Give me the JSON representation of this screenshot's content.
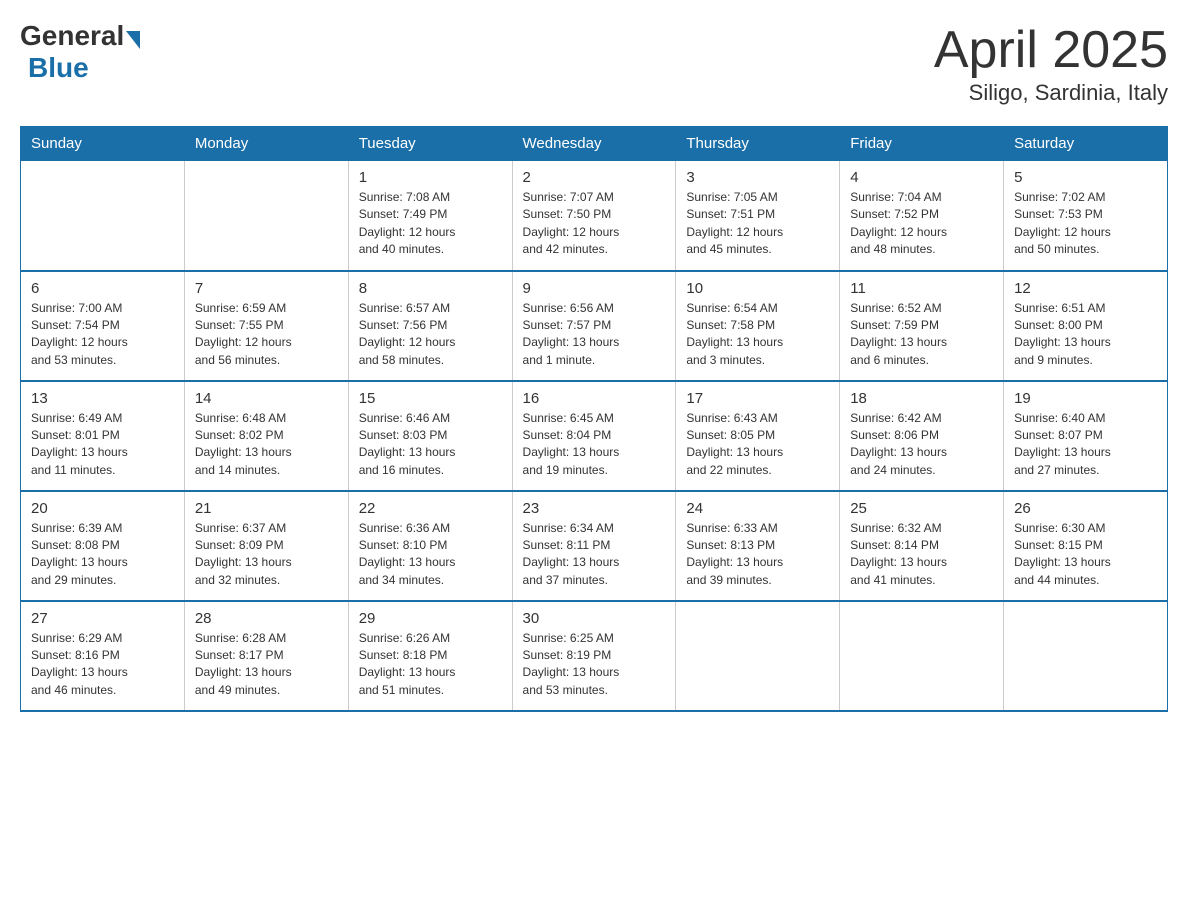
{
  "logo": {
    "general": "General",
    "blue": "Blue"
  },
  "title": "April 2025",
  "location": "Siligo, Sardinia, Italy",
  "days_of_week": [
    "Sunday",
    "Monday",
    "Tuesday",
    "Wednesday",
    "Thursday",
    "Friday",
    "Saturday"
  ],
  "weeks": [
    [
      {
        "day": "",
        "info": ""
      },
      {
        "day": "",
        "info": ""
      },
      {
        "day": "1",
        "info": "Sunrise: 7:08 AM\nSunset: 7:49 PM\nDaylight: 12 hours\nand 40 minutes."
      },
      {
        "day": "2",
        "info": "Sunrise: 7:07 AM\nSunset: 7:50 PM\nDaylight: 12 hours\nand 42 minutes."
      },
      {
        "day": "3",
        "info": "Sunrise: 7:05 AM\nSunset: 7:51 PM\nDaylight: 12 hours\nand 45 minutes."
      },
      {
        "day": "4",
        "info": "Sunrise: 7:04 AM\nSunset: 7:52 PM\nDaylight: 12 hours\nand 48 minutes."
      },
      {
        "day": "5",
        "info": "Sunrise: 7:02 AM\nSunset: 7:53 PM\nDaylight: 12 hours\nand 50 minutes."
      }
    ],
    [
      {
        "day": "6",
        "info": "Sunrise: 7:00 AM\nSunset: 7:54 PM\nDaylight: 12 hours\nand 53 minutes."
      },
      {
        "day": "7",
        "info": "Sunrise: 6:59 AM\nSunset: 7:55 PM\nDaylight: 12 hours\nand 56 minutes."
      },
      {
        "day": "8",
        "info": "Sunrise: 6:57 AM\nSunset: 7:56 PM\nDaylight: 12 hours\nand 58 minutes."
      },
      {
        "day": "9",
        "info": "Sunrise: 6:56 AM\nSunset: 7:57 PM\nDaylight: 13 hours\nand 1 minute."
      },
      {
        "day": "10",
        "info": "Sunrise: 6:54 AM\nSunset: 7:58 PM\nDaylight: 13 hours\nand 3 minutes."
      },
      {
        "day": "11",
        "info": "Sunrise: 6:52 AM\nSunset: 7:59 PM\nDaylight: 13 hours\nand 6 minutes."
      },
      {
        "day": "12",
        "info": "Sunrise: 6:51 AM\nSunset: 8:00 PM\nDaylight: 13 hours\nand 9 minutes."
      }
    ],
    [
      {
        "day": "13",
        "info": "Sunrise: 6:49 AM\nSunset: 8:01 PM\nDaylight: 13 hours\nand 11 minutes."
      },
      {
        "day": "14",
        "info": "Sunrise: 6:48 AM\nSunset: 8:02 PM\nDaylight: 13 hours\nand 14 minutes."
      },
      {
        "day": "15",
        "info": "Sunrise: 6:46 AM\nSunset: 8:03 PM\nDaylight: 13 hours\nand 16 minutes."
      },
      {
        "day": "16",
        "info": "Sunrise: 6:45 AM\nSunset: 8:04 PM\nDaylight: 13 hours\nand 19 minutes."
      },
      {
        "day": "17",
        "info": "Sunrise: 6:43 AM\nSunset: 8:05 PM\nDaylight: 13 hours\nand 22 minutes."
      },
      {
        "day": "18",
        "info": "Sunrise: 6:42 AM\nSunset: 8:06 PM\nDaylight: 13 hours\nand 24 minutes."
      },
      {
        "day": "19",
        "info": "Sunrise: 6:40 AM\nSunset: 8:07 PM\nDaylight: 13 hours\nand 27 minutes."
      }
    ],
    [
      {
        "day": "20",
        "info": "Sunrise: 6:39 AM\nSunset: 8:08 PM\nDaylight: 13 hours\nand 29 minutes."
      },
      {
        "day": "21",
        "info": "Sunrise: 6:37 AM\nSunset: 8:09 PM\nDaylight: 13 hours\nand 32 minutes."
      },
      {
        "day": "22",
        "info": "Sunrise: 6:36 AM\nSunset: 8:10 PM\nDaylight: 13 hours\nand 34 minutes."
      },
      {
        "day": "23",
        "info": "Sunrise: 6:34 AM\nSunset: 8:11 PM\nDaylight: 13 hours\nand 37 minutes."
      },
      {
        "day": "24",
        "info": "Sunrise: 6:33 AM\nSunset: 8:13 PM\nDaylight: 13 hours\nand 39 minutes."
      },
      {
        "day": "25",
        "info": "Sunrise: 6:32 AM\nSunset: 8:14 PM\nDaylight: 13 hours\nand 41 minutes."
      },
      {
        "day": "26",
        "info": "Sunrise: 6:30 AM\nSunset: 8:15 PM\nDaylight: 13 hours\nand 44 minutes."
      }
    ],
    [
      {
        "day": "27",
        "info": "Sunrise: 6:29 AM\nSunset: 8:16 PM\nDaylight: 13 hours\nand 46 minutes."
      },
      {
        "day": "28",
        "info": "Sunrise: 6:28 AM\nSunset: 8:17 PM\nDaylight: 13 hours\nand 49 minutes."
      },
      {
        "day": "29",
        "info": "Sunrise: 6:26 AM\nSunset: 8:18 PM\nDaylight: 13 hours\nand 51 minutes."
      },
      {
        "day": "30",
        "info": "Sunrise: 6:25 AM\nSunset: 8:19 PM\nDaylight: 13 hours\nand 53 minutes."
      },
      {
        "day": "",
        "info": ""
      },
      {
        "day": "",
        "info": ""
      },
      {
        "day": "",
        "info": ""
      }
    ]
  ]
}
